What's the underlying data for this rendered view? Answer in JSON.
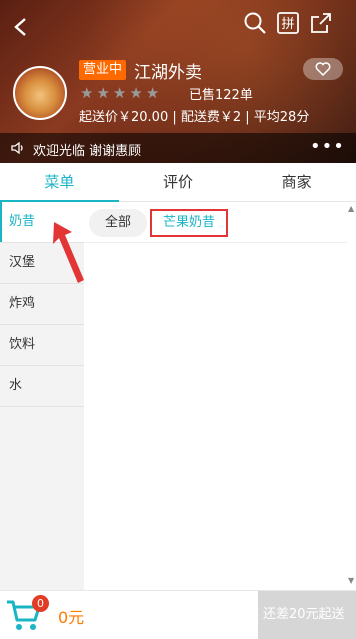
{
  "header": {
    "status_badge": "营业中",
    "shop_name": "江湖外卖",
    "rating_stars": 5,
    "sold": "已售122单",
    "info_line": "起送价￥20.00 | 配送费￥2 | 平均28分"
  },
  "notice": {
    "text": "欢迎光临 谢谢惠顾",
    "more": "•••"
  },
  "tabs": [
    {
      "label": "菜单",
      "active": true
    },
    {
      "label": "评价",
      "active": false
    },
    {
      "label": "商家",
      "active": false
    }
  ],
  "sidebar": {
    "items": [
      {
        "label": "奶昔",
        "active": true
      },
      {
        "label": "汉堡",
        "active": false
      },
      {
        "label": "炸鸡",
        "active": false
      },
      {
        "label": "饮料",
        "active": false
      },
      {
        "label": "水",
        "active": false
      }
    ]
  },
  "subtabs": {
    "all": "全部",
    "current": "芒果奶昔"
  },
  "cart": {
    "count": "0",
    "total": "0元",
    "checkout_label": "还差20元起送"
  },
  "colors": {
    "accent": "#19b5c5",
    "orange": "#ff7a00",
    "badge": "#ff6a00",
    "highlight_box": "#e23636"
  }
}
